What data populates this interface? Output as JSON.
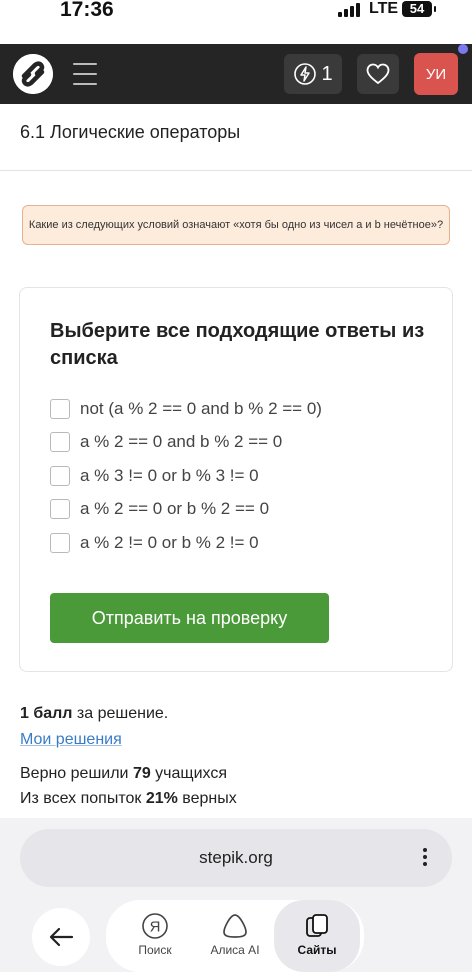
{
  "status_bar": {
    "time": "17:36",
    "network": "LTE",
    "battery": "54"
  },
  "header": {
    "energy_count": "1",
    "avatar_initials": "УИ"
  },
  "lesson": {
    "title": "6.1 Логические операторы"
  },
  "hint": {
    "text": "Какие из следующих условий означают «хотя бы одно из чисел a и b нечётное»?"
  },
  "quiz": {
    "title": "Выберите все подходящие ответы из списка",
    "options": [
      {
        "label": "not (a % 2 == 0 and b % 2 == 0)",
        "checked": false
      },
      {
        "label": "a % 2 == 0 and b % 2 == 0",
        "checked": false
      },
      {
        "label": "a % 3 != 0 or b % 3 != 0",
        "checked": false
      },
      {
        "label": "a % 2 == 0 or b % 2 == 0",
        "checked": false
      },
      {
        "label": "a % 2 != 0 or b % 2 != 0",
        "checked": false
      }
    ],
    "submit_label": "Отправить на проверку"
  },
  "footer": {
    "score_bold": "1 балл",
    "score_rest": " за решение.",
    "my_solutions": "Мои решения",
    "solved_prefix": "Верно решили ",
    "solved_count": "79",
    "solved_suffix": " учащихся",
    "attempts_prefix": "Из всех попыток ",
    "attempts_percent": "21%",
    "attempts_suffix": " верных"
  },
  "browser": {
    "url": "stepik.org",
    "nav": [
      {
        "label": "Поиск",
        "icon": "yandex-search-icon"
      },
      {
        "label": "Алиса AI",
        "icon": "alice-icon"
      },
      {
        "label": "Сайты",
        "icon": "sites-icon",
        "active": true
      }
    ]
  },
  "colors": {
    "header_bg": "#252526",
    "submit_green": "#4b9a3a",
    "avatar_red": "#d9534f",
    "link_blue": "#3a7bc8",
    "hint_bg": "#fdebdc"
  }
}
